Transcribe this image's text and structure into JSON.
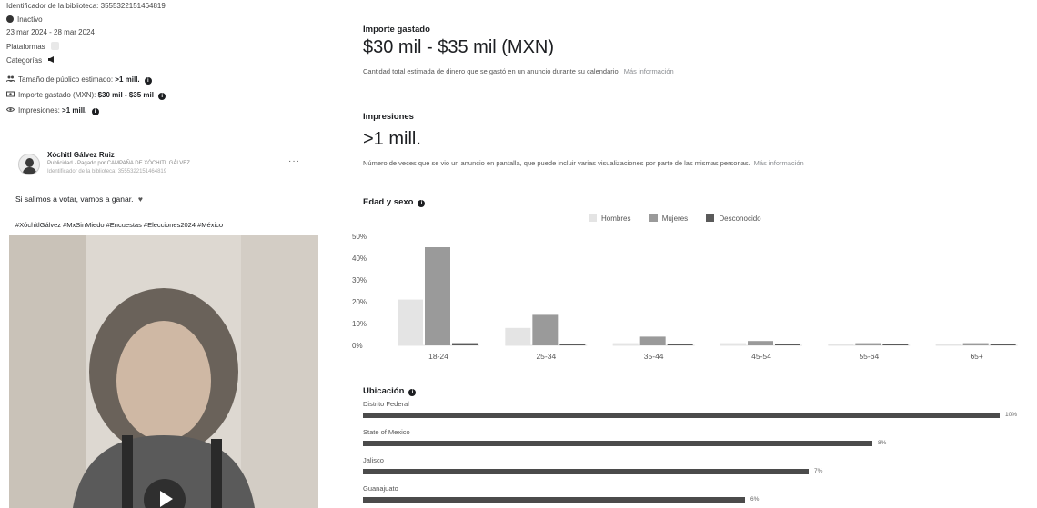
{
  "meta": {
    "library_id": "Identificador de la biblioteca: 3555322151464819",
    "status": "Inactivo",
    "dates": "23 mar 2024 - 28 mar 2024",
    "platforms_label": "Plataformas",
    "categories_label": "Categorías",
    "audience_label": "Tamaño de público estimado:",
    "audience_value": ">1 mill.",
    "spend_label": "Importe gastado (MXN):",
    "spend_value": "$30 mil - $35 mil",
    "impressions_label": "Impresiones:",
    "impressions_value": ">1 mill."
  },
  "advertiser": {
    "name": "Xóchitl Gálvez Ruiz",
    "paid_by": "Publicidad · Pagado por CAMPAÑA DE XÓCHITL GÁLVEZ",
    "library_id": "Identificador de la biblioteca: 3555322151464819",
    "more": "···"
  },
  "post": {
    "text": "Si salimos a votar, vamos a ganar. ",
    "hashtags": "#XóchitlGálvez #MxSinMiedo #Encuestas #Elecciones2024 #México"
  },
  "spend_section": {
    "title": "Importe gastado",
    "value": "$30 mil - $35 mil (MXN)",
    "description": "Cantidad total estimada de dinero que se gastó en un anuncio durante su calendario.",
    "more_link": "Más información"
  },
  "impressions_section": {
    "title": "Impresiones",
    "value": ">1 mill.",
    "description": "Número de veces que se vio un anuncio en pantalla, que puede incluir varias visualizaciones por parte de las mismas personas.",
    "more_link": "Más información"
  },
  "age_gender": {
    "title": "Edad y sexo",
    "legend": [
      "Hombres",
      "Mujeres",
      "Desconocido"
    ]
  },
  "colors": {
    "hombres": "#e4e4e4",
    "mujeres": "#9a9a9a",
    "desconocido": "#5a5a5a",
    "bar": "#4b4b4b"
  },
  "chart_data": {
    "type": "bar",
    "title": "Edad y sexo",
    "categories": [
      "18-24",
      "25-34",
      "35-44",
      "45-54",
      "55-64",
      "65+"
    ],
    "series": [
      {
        "name": "Hombres",
        "values": [
          21,
          8,
          1,
          1,
          0.3,
          0.3
        ]
      },
      {
        "name": "Mujeres",
        "values": [
          45,
          14,
          4,
          2,
          1,
          1
        ]
      },
      {
        "name": "Desconocido",
        "values": [
          1,
          0.2,
          0.1,
          0.1,
          0.1,
          0.1
        ]
      }
    ],
    "yticks": [
      "50%",
      "40%",
      "30%",
      "20%",
      "10%",
      "0%"
    ],
    "ylim": [
      0,
      50
    ],
    "legend": "top-center",
    "grid": false
  },
  "location": {
    "title": "Ubicación",
    "rows": [
      {
        "name": "Distrito Federal",
        "pct": "10%",
        "value": 10
      },
      {
        "name": "State of Mexico",
        "pct": "8%",
        "value": 8
      },
      {
        "name": "Jalisco",
        "pct": "7%",
        "value": 7
      },
      {
        "name": "Guanajuato",
        "pct": "6%",
        "value": 6
      }
    ]
  }
}
